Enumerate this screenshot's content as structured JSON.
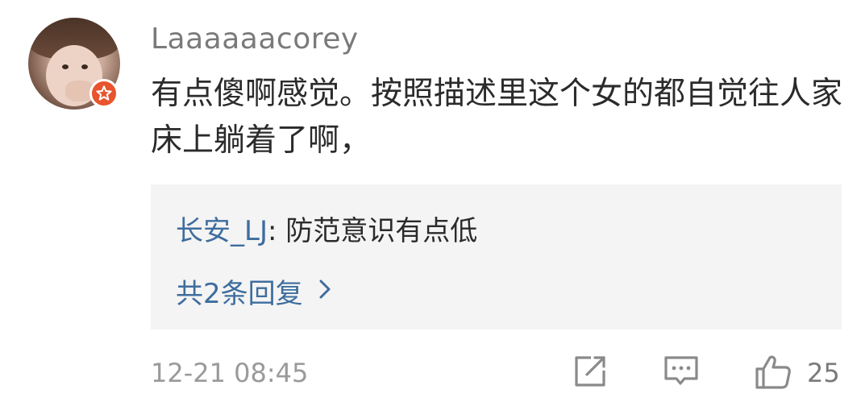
{
  "comment": {
    "username": "Laaaaaacorey",
    "content": "有点傻啊感觉。按照描述里这个女的都自觉往人家床上躺着了啊，",
    "timestamp": "12-21 08:45",
    "like_count": "25"
  },
  "reply": {
    "author": "长安_LJ",
    "separator": ":",
    "text": "防范意识有点低",
    "more_label": "共2条回复"
  },
  "colors": {
    "link_blue": "#3e6d9e",
    "badge_orange": "#e8542e",
    "reply_bg": "#f4f4f4",
    "icon_gray": "#8a8a8a"
  },
  "icons": {
    "badge": "star-badge-icon",
    "forward": "forward-icon",
    "comment": "comment-icon",
    "like": "thumbs-up-icon",
    "more": "chevron-right-icon"
  }
}
